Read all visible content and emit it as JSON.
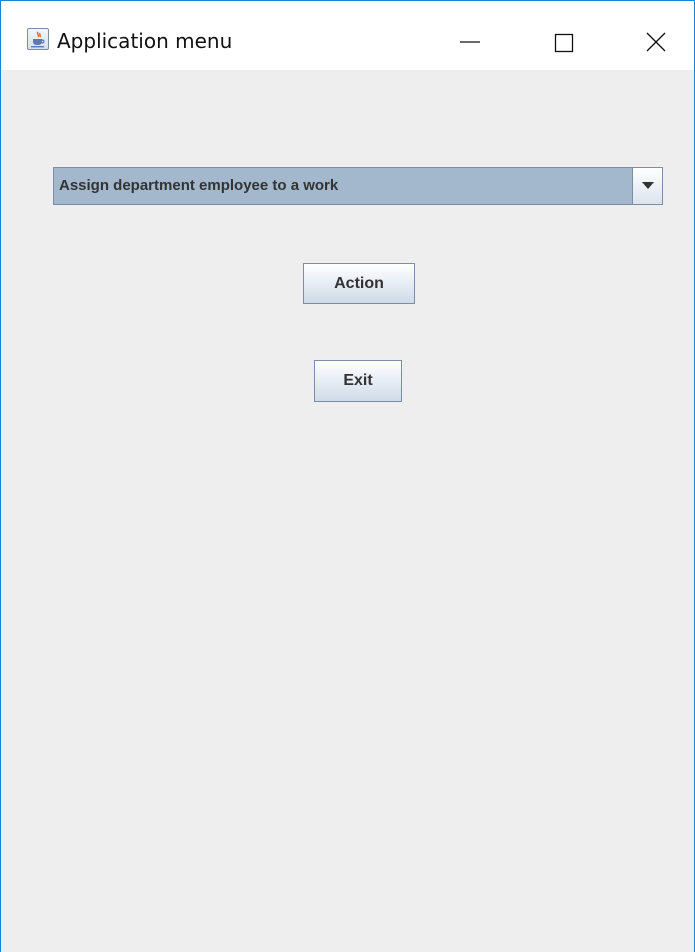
{
  "window": {
    "title": "Application menu",
    "app_icon": "java-cup-icon",
    "controls": {
      "minimize": "minimize-icon",
      "maximize": "maximize-icon",
      "close": "close-icon"
    }
  },
  "main": {
    "dropdown": {
      "selected": "Assign department employee to a work",
      "arrow_icon": "chevron-down-icon"
    },
    "action_label": "Action",
    "exit_label": "Exit"
  },
  "colors": {
    "window_border": "#1883d7",
    "content_background": "#eeeeee",
    "combo_background": "#a3b8cc"
  }
}
